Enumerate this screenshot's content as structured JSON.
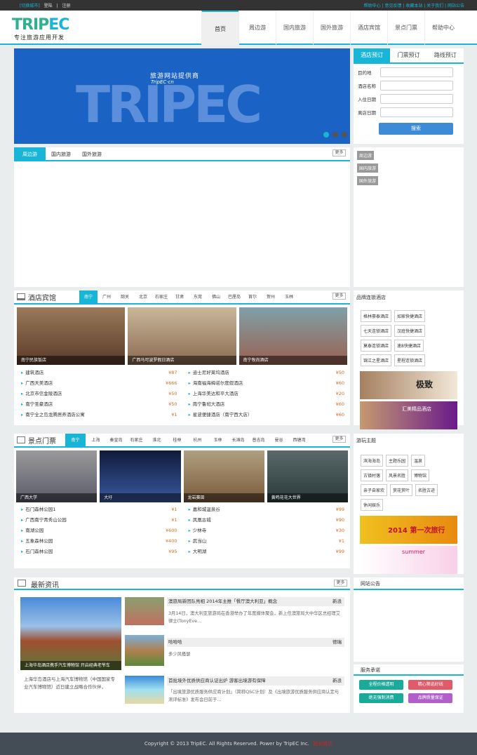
{
  "topbar": {
    "city_label": "[切换城市]",
    "login": "登陆",
    "sep": "|",
    "register": "注册",
    "links": "帮助中心 | 意见反馈 | 收藏本站 | 关于我们 | 网站公告"
  },
  "logo": {
    "trip": "TRIP",
    "ec": "EC",
    "sub": "专注旅游应用开发"
  },
  "nav": [
    "首页",
    "周边游",
    "国内旅游",
    "国外旅游",
    "酒店宾馆",
    "景点门票",
    "帮助中心"
  ],
  "banner": {
    "line1": "旅游网站提供商",
    "line2": "TripEC·cn",
    "big": "TRIPEC"
  },
  "booking": {
    "tabs": [
      "酒店预订",
      "门票预订",
      "路线预订"
    ],
    "fields": [
      "目的地",
      "酒店名称",
      "入住日期",
      "离店日期"
    ],
    "search": "搜索"
  },
  "tabs1": {
    "tabs": [
      "周边游",
      "国内旅游",
      "国外旅游"
    ],
    "more": "更多",
    "side_tags": [
      "周边游",
      "国内旅游",
      "国外旅游"
    ]
  },
  "hotel": {
    "title": "酒店宾馆",
    "more": "更多",
    "cities": [
      "南宁",
      "广州",
      "韶关",
      "北京",
      "石家庄",
      "甘肃",
      "东莞",
      "佛山",
      "巴厘岛",
      "首尔",
      "贺州",
      "玉林"
    ],
    "photos": [
      "南宁民族饭店",
      "广西马可波罗假日酒店",
      "南宁牧尚酒店"
    ],
    "list_left": [
      {
        "n": "建筑酒店",
        "p": "¥87"
      },
      {
        "n": "广西天美酒店",
        "p": "¥666"
      },
      {
        "n": "北京市信金陵酒店",
        "p": "¥50"
      },
      {
        "n": "南宁圣豪酒店",
        "p": "¥50"
      },
      {
        "n": "南宁全之岛龙腾居养酒店公寓",
        "p": "¥1"
      }
    ],
    "list_right": [
      {
        "n": "迪士尼好莱坞酒店",
        "p": "¥50"
      },
      {
        "n": "海南福海梅诺尔度假酒店",
        "p": "¥60"
      },
      {
        "n": "上海华美达和平大酒店",
        "p": "¥20"
      },
      {
        "n": "南宁鲁班大酒店",
        "p": "¥60"
      },
      {
        "n": "星波便捷酒店（南宁西大店）",
        "p": "¥60"
      }
    ]
  },
  "hotel_side": {
    "title": "品牌连锁酒店",
    "brands": [
      "格林豪泰酒店",
      "如家快捷酒店",
      "七天连锁酒店",
      "汉庭快捷酒店",
      "莫泰连锁酒店",
      "速8快捷酒店",
      "锦江之星酒店",
      "星程连锁酒店"
    ],
    "promo1": "极致",
    "promo2": "汇美精品酒店"
  },
  "scenic": {
    "title": "景点门票",
    "more": "更多",
    "cities": [
      "南宁",
      "上海",
      "秦皇岛",
      "石家庄",
      "淮北",
      "桂林",
      "杭州",
      "玉林",
      "长滩岛",
      "普吉岛",
      "曼谷",
      "西塘湾"
    ],
    "photos": [
      "广西大学",
      "大圩",
      "龙岩赛田",
      "黄鸣花花大世界"
    ],
    "list_left": [
      {
        "n": "石门森林公园1",
        "p": "¥1"
      },
      {
        "n": "广西南宁青秀山公园",
        "p": "¥1"
      },
      {
        "n": "南湖公园",
        "p": "¥600"
      },
      {
        "n": "五象森林公园",
        "p": "¥400"
      },
      {
        "n": "石门森林公园",
        "p": "¥95"
      }
    ],
    "list_right": [
      {
        "n": "嘉和城温泉谷",
        "p": "¥99"
      },
      {
        "n": "凤凰古城",
        "p": "¥90"
      },
      {
        "n": "少林寺",
        "p": "¥30"
      },
      {
        "n": "武当山",
        "p": "¥1"
      },
      {
        "n": "大明湖",
        "p": "¥99"
      }
    ]
  },
  "scenic_side": {
    "title": "游玩主题",
    "themes": [
      "滨海海岛",
      "主题乐园",
      "温泉",
      "古镇村落",
      "风景名胜",
      "博物馆",
      "亲子自家欢",
      "赏花赏叶",
      "名胜古迹",
      "休闲娱乐"
    ],
    "promo1": "2014 第一次旅行",
    "promo2": "summer"
  },
  "news": {
    "title": "最新资讯",
    "more": "更多",
    "main_caption": "上海华岛酒店携手汽车博物馆 开启经典老爷车",
    "main_text": "上海华岛酒店与上海汽车博物馆（中国国家专业汽车博物馆）近日建立战略合作伙伴，",
    "items": [
      {
        "t": "澳旅局新团队亮相 2014年主推「餐厅澳大利亚」概念",
        "tag": "新浪",
        "d": "3月14日，澳大利亚旅游局在香港举办了年度媒体聚会，新上任澳旅局大中华区总经理艾律立(TonyEve…"
      },
      {
        "t": "哈哈哈",
        "tag": "德瑞",
        "d": "多少风搔瑟"
      },
      {
        "t": "首批境外优质供应商认证出炉 游客出境游有保障",
        "tag": "新浪",
        "d": "「出境旅游优质服务供应商计划」（简称QSC计划）及《出境旅游优质服务供应商认定与测评标准》发布会日前于…"
      }
    ]
  },
  "announce": {
    "title": "网站公告"
  },
  "service": {
    "title": "服务承诺",
    "items": [
      "全程价格透明",
      "精心筛选好线",
      "绝无强制消费",
      "品牌质量保证"
    ]
  },
  "footer": {
    "text": "Copyright © 2013 TripEC. All Rights Reserved. Power by TripEC Inc.",
    "badge": "站长统计"
  },
  "colors": {
    "accent": "#19b5d7",
    "banner": "#1a63c5",
    "price": "#e06b1e",
    "footer": "#444d56"
  }
}
